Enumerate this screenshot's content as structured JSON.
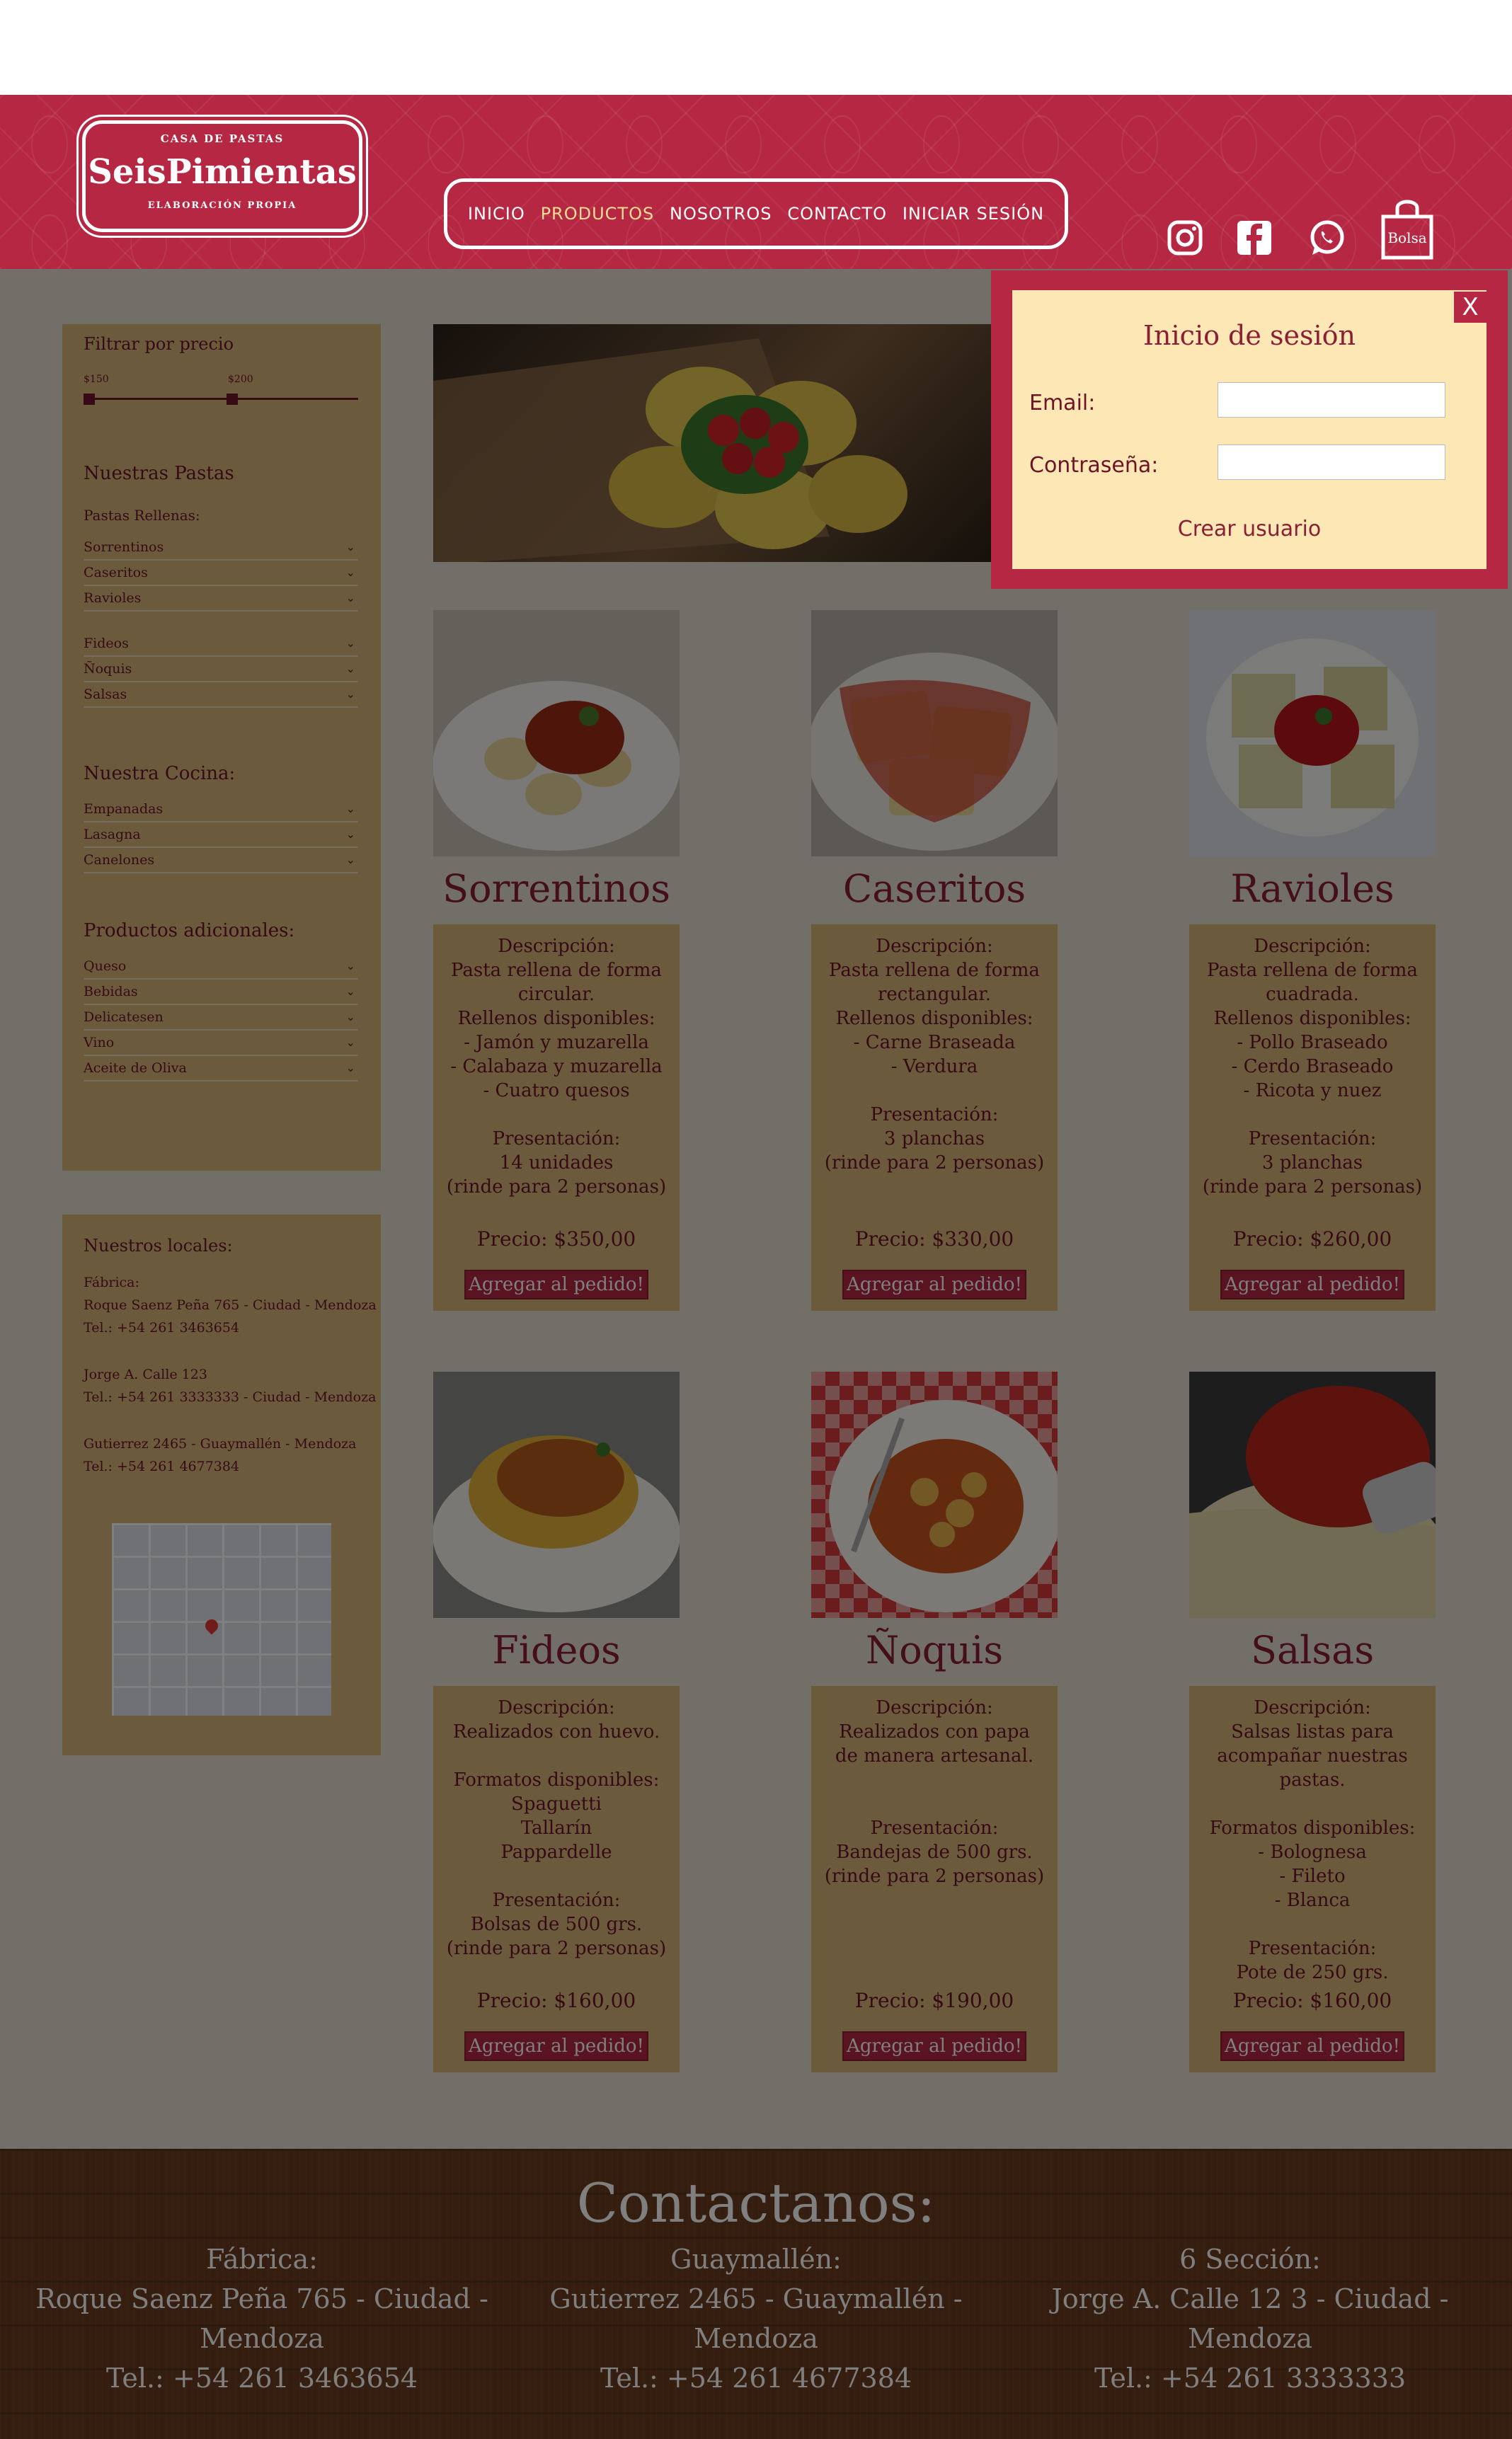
{
  "header": {
    "logo_top": "CASA DE PASTAS",
    "logo_brand": "SeisPimientas",
    "logo_bottom": "ELABORACIÓN PROPIA",
    "nav": [
      "INICIO",
      "PRODUCTOS",
      "NOSOTROS",
      "CONTACTO",
      "INICIAR SESIÓN"
    ],
    "active_nav": "PRODUCTOS",
    "bag_label": "Bolsa",
    "icons": [
      "instagram-icon",
      "facebook-icon",
      "whatsapp-icon",
      "shopping-bag-icon"
    ]
  },
  "sidebar": {
    "filter_title": "Filtrar por precio",
    "price_min": "$150",
    "price_max": "$200",
    "pastas_title": "Nuestras Pastas",
    "rellenas_label": "Pastas Rellenas:",
    "rellenas": [
      "Sorrentinos",
      "Caseritos",
      "Ravioles"
    ],
    "otras": [
      "Fideos",
      "Ñoquis",
      "Salsas"
    ],
    "cocina_title": "Nuestra Cocina:",
    "cocina": [
      "Empanadas",
      "Lasagna",
      "Canelones"
    ],
    "adicionales_title": "Productos adicionales:",
    "adicionales": [
      "Queso",
      "Bebidas",
      "Delicatesen",
      "Vino",
      "Aceite de Oliva"
    ],
    "chevron": "⌄"
  },
  "locales": {
    "title": "Nuestros locales:",
    "fabrica_label": "Fábrica:",
    "fabrica_addr": "Roque Saenz Peña 765 - Ciudad - Mendoza",
    "fabrica_tel": "Tel.: +54 261 3463654",
    "loc2_addr": "Jorge A. Calle 123",
    "loc2_tel": "Tel.: +54 261 3333333 - Ciudad - Mendoza",
    "loc3_addr": "Gutierrez 2465 - Guaymallén - Mendoza",
    "loc3_tel": "Tel.: +54 261 4677384"
  },
  "products": [
    {
      "name": "Sorrentinos",
      "lines": [
        "Descripción:",
        "Pasta rellena de forma",
        "circular.",
        "Rellenos disponibles:",
        "- Jamón y muzarella",
        "- Calabaza y muzarella",
        "- Cuatro quesos",
        "",
        "Presentación:",
        "14 unidades",
        "(rinde para 2 personas)"
      ],
      "price": "Precio: $350,00",
      "button": "Agregar al pedido!"
    },
    {
      "name": "Caseritos",
      "lines": [
        "Descripción:",
        "Pasta rellena de forma",
        "rectangular.",
        "Rellenos disponibles:",
        "- Carne Braseada",
        "- Verdura",
        "",
        "Presentación:",
        "3 planchas",
        "(rinde para 2 personas)"
      ],
      "price": "Precio: $330,00",
      "button": "Agregar al pedido!"
    },
    {
      "name": "Ravioles",
      "lines": [
        "Descripción:",
        "Pasta rellena de forma",
        "cuadrada.",
        "Rellenos disponibles:",
        "- Pollo Braseado",
        "- Cerdo Braseado",
        "- Ricota y nuez",
        "",
        "Presentación:",
        "3 planchas",
        "(rinde para 2 personas)"
      ],
      "price": "Precio: $260,00",
      "button": "Agregar al pedido!"
    },
    {
      "name": "Fideos",
      "lines": [
        "Descripción:",
        "Realizados con huevo.",
        "",
        "Formatos disponibles:",
        "Spaguetti",
        "Tallarín",
        "Pappardelle",
        "",
        "Presentación:",
        "Bolsas de 500 grs.",
        "(rinde para 2 personas)"
      ],
      "price": "Precio: $160,00",
      "button": "Agregar al pedido!"
    },
    {
      "name": "Ñoquis",
      "lines": [
        "Descripción:",
        "Realizados con papa",
        "de manera artesanal.",
        "",
        "",
        "Presentación:",
        "Bandejas de 500 grs.",
        "(rinde para 2 personas)"
      ],
      "price": "Precio: $190,00",
      "button": "Agregar al pedido!"
    },
    {
      "name": "Salsas",
      "lines": [
        "Descripción:",
        "Salsas listas para",
        "acompañar nuestras pastas.",
        "",
        "Formatos disponibles:",
        "- Bolognesa",
        "- Fileto",
        "- Blanca",
        "",
        "Presentación:",
        "Pote de 250 grs."
      ],
      "price": "Precio: $160,00",
      "button": "Agregar al pedido!"
    }
  ],
  "footer": {
    "title": "Contactanos:",
    "cols": [
      {
        "title": "Fábrica:",
        "addr": "Roque Saenz Peña 765 - Ciudad - Mendoza",
        "tel": "Tel.: +54 261 3463654"
      },
      {
        "title": "Guaymallén:",
        "addr": "Gutierrez 2465 - Guaymallén - Mendoza",
        "tel": "Tel.: +54 261 4677384"
      },
      {
        "title": "6 Sección:",
        "addr": "Jorge A. Calle 12 3 - Ciudad - Mendoza",
        "tel": "Tel.: +54 261 3333333"
      }
    ]
  },
  "login": {
    "close": "X",
    "title": "Inicio de sesión",
    "email_label": "Email:",
    "email_value": "",
    "password_label": "Contraseña:",
    "password_value": "",
    "create_user": "Crear usuario"
  },
  "colors": {
    "brand_red": "#b52742",
    "dark_red": "#6d1428",
    "card_tan": "#d9b47a",
    "page_bg": "#e4dfd2",
    "modal_bg": "#fde7b5"
  }
}
